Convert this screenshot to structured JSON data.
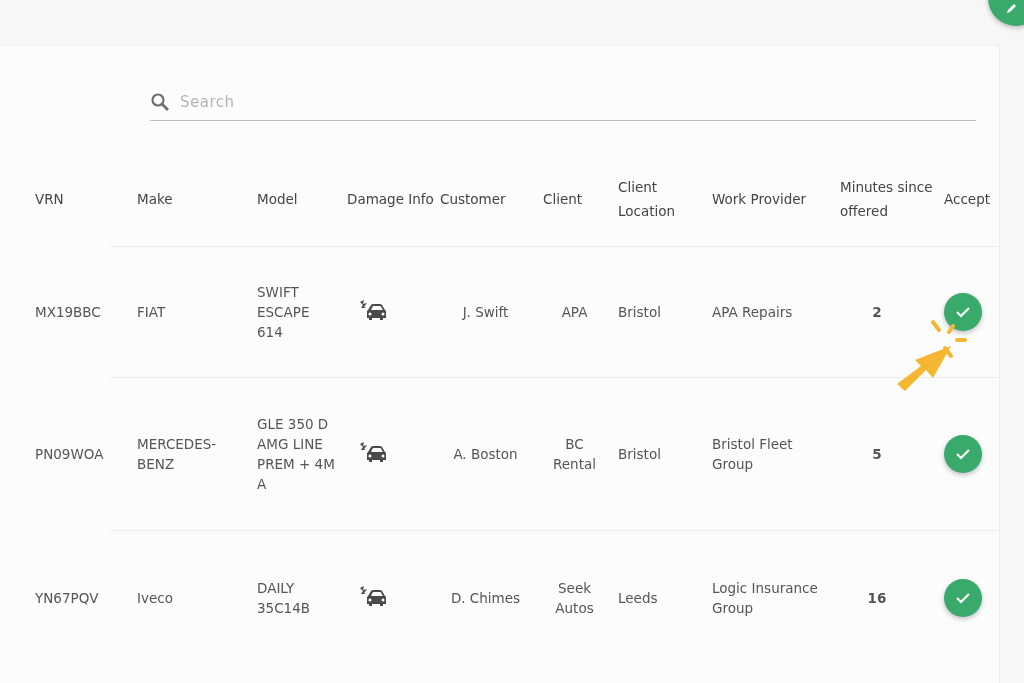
{
  "search": {
    "placeholder": "Search"
  },
  "table": {
    "columns": [
      "VRN",
      "Make",
      "Model",
      "Damage Info",
      "Customer",
      "Client",
      "Client Location",
      "Work Provider",
      "Minutes since offered",
      "Accept"
    ],
    "rows": [
      {
        "vrn": "MX19BBC",
        "make": "FIAT",
        "model": "SWIFT ESCAPE 614",
        "customer": "J. Swift",
        "client": "APA",
        "location": "Bristol",
        "work_provider": "APA Repairs",
        "minutes": "2"
      },
      {
        "vrn": "PN09WOA",
        "make": "MERCEDES-BENZ",
        "model": "GLE 350 D AMG LINE PREM + 4M A",
        "customer": "A. Boston",
        "client": "BC Rental",
        "location": "Bristol",
        "work_provider": "Bristol Fleet Group",
        "minutes": "5"
      },
      {
        "vrn": "YN67PQV",
        "make": "Iveco",
        "model": "DAILY 35C14B",
        "customer": "D. Chimes",
        "client": "Seek Autos",
        "location": "Leeds",
        "work_provider": "Logic Insurance Group",
        "minutes": "16"
      }
    ]
  }
}
